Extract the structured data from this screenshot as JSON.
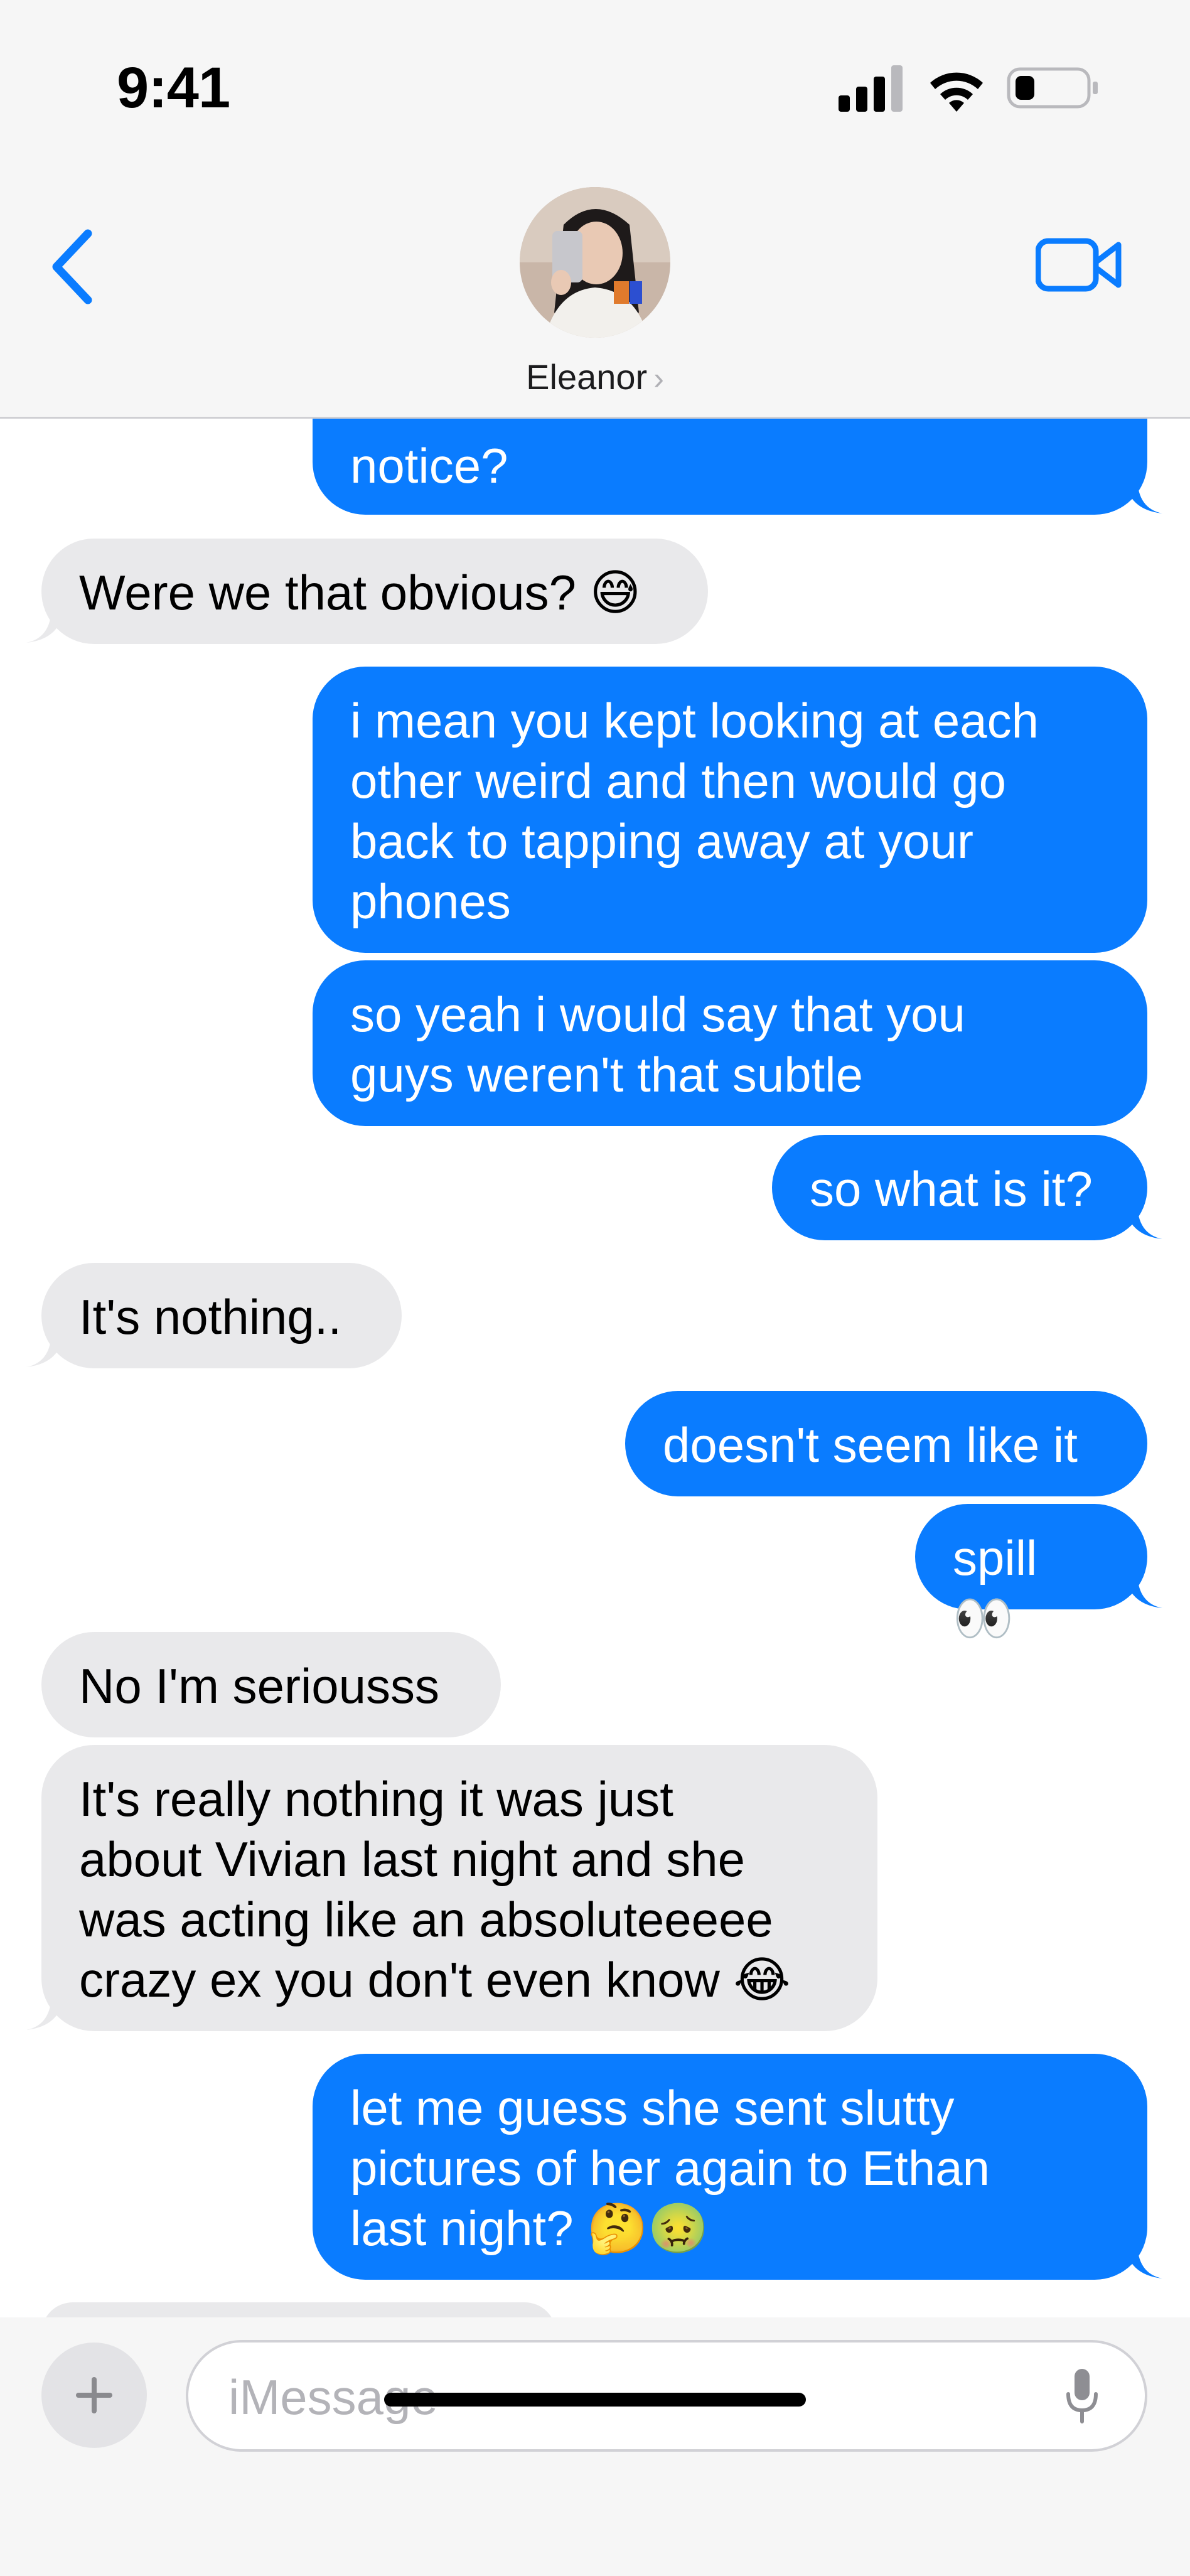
{
  "status_bar": {
    "time": "9:41"
  },
  "header": {
    "contact_name": "Eleanor",
    "name_chevron": "›"
  },
  "icons": {
    "back": "chevron-left-icon",
    "video": "video-camera-icon",
    "plus": "plus-icon",
    "mic": "microphone-icon"
  },
  "colors": {
    "outgoing": "#0a7cff",
    "incoming": "#e9e9eb",
    "accent": "#0a7cff"
  },
  "messages": [
    {
      "from": "me",
      "text": "notice?"
    },
    {
      "from": "them",
      "text": "Were we that obvious? 😅"
    },
    {
      "from": "me",
      "text": "i mean you kept looking at each\nother weird and then would go\nback to tapping away at your\nphones"
    },
    {
      "from": "me",
      "text": "so yeah i would say that you\nguys weren't that subtle"
    },
    {
      "from": "me",
      "text": "so what is it?"
    },
    {
      "from": "them",
      "text": "It's nothing.."
    },
    {
      "from": "me",
      "text": "doesn't seem like it"
    },
    {
      "from": "me",
      "text": "spill 👀"
    },
    {
      "from": "them",
      "text": "No I'm seriousss"
    },
    {
      "from": "them",
      "text": "It's really nothing it was just\nabout Vivian last night and she\nwas acting like an absoluteeeee\ncrazy ex you don't even know 😂"
    },
    {
      "from": "me",
      "text": "let me guess she sent slutty\npictures of her again to Ethan\nlast night? 🤔🤢"
    }
  ],
  "input": {
    "placeholder": "iMessage"
  }
}
